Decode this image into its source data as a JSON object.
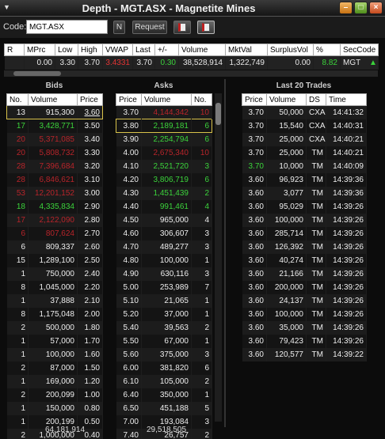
{
  "window": {
    "title": "Depth - MGT.ASX - Magnetite Mines"
  },
  "icons": {
    "system": "menu-icon",
    "minimize": "minimize-icon",
    "maximize": "maximize-icon",
    "close": "close-icon"
  },
  "toolbar": {
    "code_label": "Code:",
    "code_value": "MGT.ASX",
    "n_label": "N",
    "request_label": "Request"
  },
  "summary": {
    "headers": [
      "R",
      "MPrc",
      "Low",
      "High",
      "VWAP",
      "Last",
      "+/-",
      "Volume",
      "MktVal",
      "SurplusVol",
      "%",
      "SecCode"
    ],
    "row": [
      "",
      "0.00",
      "3.30",
      "3.70",
      "3.4331",
      "3.70",
      "0.30",
      "38,528,914",
      "1,322,749",
      "0.00",
      "8.82",
      "MGT"
    ]
  },
  "bids": {
    "title": "Bids",
    "headers": [
      "No.",
      "Volume",
      "Price"
    ],
    "rows": [
      [
        "13",
        "915,300",
        "3.60"
      ],
      [
        "17",
        "3,428,771",
        "3.50"
      ],
      [
        "20",
        "5,371,085",
        "3.40"
      ],
      [
        "20",
        "5,808,732",
        "3.30"
      ],
      [
        "28",
        "7,396,684",
        "3.20"
      ],
      [
        "28",
        "6,846,621",
        "3.10"
      ],
      [
        "53",
        "12,201,152",
        "3.00"
      ],
      [
        "18",
        "4,335,834",
        "2.90"
      ],
      [
        "17",
        "2,122,090",
        "2.80"
      ],
      [
        "6",
        "807,624",
        "2.70"
      ],
      [
        "6",
        "809,337",
        "2.60"
      ],
      [
        "15",
        "1,289,100",
        "2.50"
      ],
      [
        "1",
        "750,000",
        "2.40"
      ],
      [
        "8",
        "1,045,000",
        "2.20"
      ],
      [
        "1",
        "37,888",
        "2.10"
      ],
      [
        "8",
        "1,175,048",
        "2.00"
      ],
      [
        "2",
        "500,000",
        "1.80"
      ],
      [
        "1",
        "57,000",
        "1.70"
      ],
      [
        "1",
        "100,000",
        "1.60"
      ],
      [
        "2",
        "87,000",
        "1.50"
      ],
      [
        "1",
        "169,000",
        "1.20"
      ],
      [
        "2",
        "200,099",
        "1.00"
      ],
      [
        "1",
        "150,000",
        "0.80"
      ],
      [
        "1",
        "200,199",
        "0.50"
      ],
      [
        "2",
        "1,000,000",
        "0.40"
      ]
    ],
    "total": "64,181,914"
  },
  "asks": {
    "title": "Asks",
    "headers": [
      "Price",
      "Volume",
      "No."
    ],
    "rows": [
      [
        "3.70",
        "4,144,342",
        "10"
      ],
      [
        "3.80",
        "2,189,181",
        "6"
      ],
      [
        "3.90",
        "2,254,794",
        "6"
      ],
      [
        "4.00",
        "2,675,340",
        "10"
      ],
      [
        "4.10",
        "2,521,720",
        "3"
      ],
      [
        "4.20",
        "3,806,719",
        "6"
      ],
      [
        "4.30",
        "1,451,439",
        "2"
      ],
      [
        "4.40",
        "991,461",
        "4"
      ],
      [
        "4.50",
        "965,000",
        "4"
      ],
      [
        "4.60",
        "306,607",
        "3"
      ],
      [
        "4.70",
        "489,277",
        "3"
      ],
      [
        "4.80",
        "100,000",
        "1"
      ],
      [
        "4.90",
        "630,116",
        "3"
      ],
      [
        "5.00",
        "253,989",
        "7"
      ],
      [
        "5.10",
        "21,065",
        "1"
      ],
      [
        "5.20",
        "37,000",
        "1"
      ],
      [
        "5.40",
        "39,563",
        "2"
      ],
      [
        "5.50",
        "67,000",
        "1"
      ],
      [
        "5.60",
        "375,000",
        "3"
      ],
      [
        "6.00",
        "381,820",
        "6"
      ],
      [
        "6.10",
        "105,000",
        "2"
      ],
      [
        "6.40",
        "350,000",
        "1"
      ],
      [
        "6.50",
        "451,188",
        "5"
      ],
      [
        "7.00",
        "193,084",
        "3"
      ],
      [
        "7.40",
        "26,757",
        "2"
      ]
    ],
    "total": "29,518,505"
  },
  "trades": {
    "title": "Last 20 Trades",
    "headers": [
      "Price",
      "Volume",
      "DS",
      "Time"
    ],
    "rows": [
      [
        "3.70",
        "50,000",
        "CXA",
        "14:41:32"
      ],
      [
        "3.70",
        "15,540",
        "CXA",
        "14:40:31"
      ],
      [
        "3.70",
        "25,000",
        "CXA",
        "14:40:21"
      ],
      [
        "3.70",
        "25,000",
        "TM",
        "14:40:21"
      ],
      [
        "3.70",
        "10,000",
        "TM",
        "14:40:09"
      ],
      [
        "3.60",
        "96,923",
        "TM",
        "14:39:36"
      ],
      [
        "3.60",
        "3,077",
        "TM",
        "14:39:36"
      ],
      [
        "3.60",
        "95,029",
        "TM",
        "14:39:26"
      ],
      [
        "3.60",
        "100,000",
        "TM",
        "14:39:26"
      ],
      [
        "3.60",
        "285,714",
        "TM",
        "14:39:26"
      ],
      [
        "3.60",
        "126,392",
        "TM",
        "14:39:26"
      ],
      [
        "3.60",
        "40,274",
        "TM",
        "14:39:26"
      ],
      [
        "3.60",
        "21,166",
        "TM",
        "14:39:26"
      ],
      [
        "3.60",
        "200,000",
        "TM",
        "14:39:26"
      ],
      [
        "3.60",
        "24,137",
        "TM",
        "14:39:26"
      ],
      [
        "3.60",
        "100,000",
        "TM",
        "14:39:26"
      ],
      [
        "3.60",
        "35,000",
        "TM",
        "14:39:26"
      ],
      [
        "3.60",
        "79,423",
        "TM",
        "14:39:26"
      ],
      [
        "3.60",
        "120,577",
        "TM",
        "14:39:22"
      ]
    ]
  },
  "colors": {
    "up": "#3bd33b",
    "down": "#e43434",
    "highlight": "#d8c24a"
  }
}
